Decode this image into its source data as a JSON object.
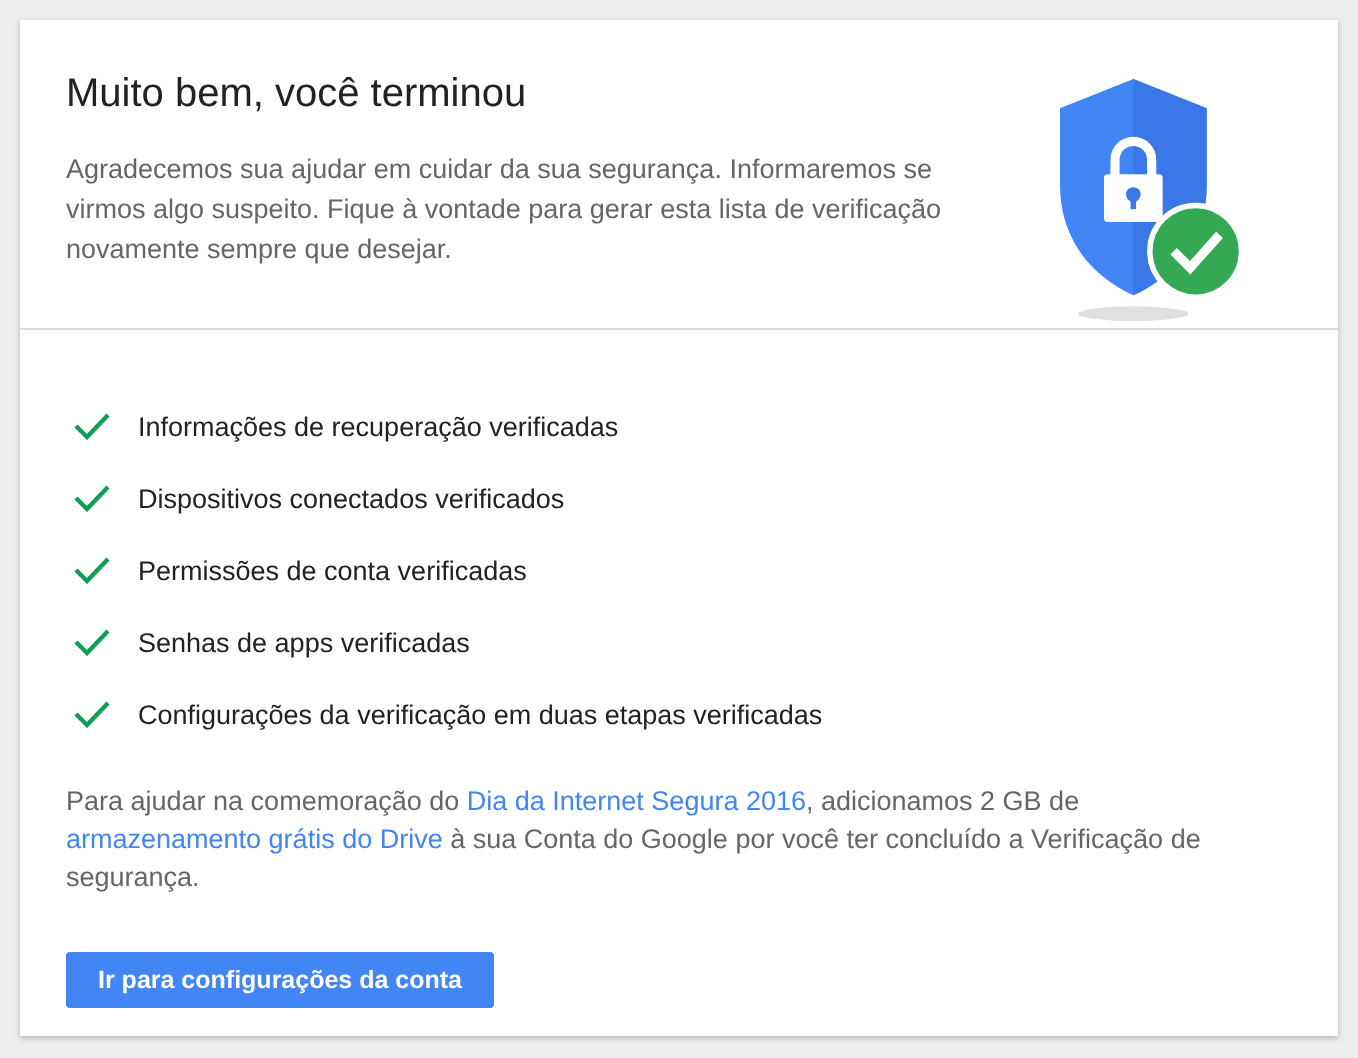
{
  "card": {
    "title": "Muito bem, você terminou",
    "description": "Agradecemos sua ajudar em cuidar da sua segurança. Informaremos se virmos algo suspeito. Fique à vontade para gerar esta lista de verificação novamente sempre que desejar.",
    "checklist": [
      {
        "label": "Informações de recuperação verificadas",
        "checked": true
      },
      {
        "label": "Dispositivos conectados verificados",
        "checked": true
      },
      {
        "label": "Permissões de conta verificadas",
        "checked": true
      },
      {
        "label": "Senhas de apps verificadas",
        "checked": true
      },
      {
        "label": "Configurações da verificação em duas etapas verificadas",
        "checked": true
      }
    ],
    "note": [
      {
        "kind": "text",
        "text": "Para ajudar na comemoração do "
      },
      {
        "kind": "link",
        "text": "Dia da Internet Segura 2016"
      },
      {
        "kind": "text",
        "text": ", adicionamos 2 GB de "
      },
      {
        "kind": "link",
        "text": "armazenamento grátis do Drive"
      },
      {
        "kind": "text",
        "text": " à sua Conta do Google por você ter concluído a Verificação de segurança."
      }
    ],
    "button": "Ir para configurações da conta"
  }
}
